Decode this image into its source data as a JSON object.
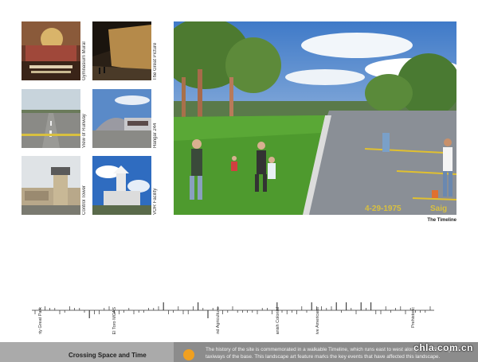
{
  "thumbnails": [
    {
      "label": "Gymnasium Mural",
      "icon": "mural-photo"
    },
    {
      "label": "The Great Picture",
      "icon": "hangar-interior-photo"
    },
    {
      "label": "View of Runway",
      "icon": "runway-photo"
    },
    {
      "label": "Hangar 244",
      "icon": "hangar-photo"
    },
    {
      "label": "Control Tower",
      "icon": "control-tower-photo"
    },
    {
      "label": "VOR Facility",
      "icon": "vor-facility-photo"
    }
  ],
  "main_image": {
    "caption": "The Timeline",
    "path_texts": [
      "4-29-1975",
      "Saig"
    ]
  },
  "timeline": {
    "labels": [
      "Orange County Great Park",
      "El Toro MCAS",
      "Statehood and Agriculture",
      "Spanish Colonial",
      "Native Americans",
      "Prehistoric"
    ]
  },
  "footer": {
    "title": "Crossing Space and Time",
    "text": "The history of the site is commemorated in a walkable Timeline, which runs east to west along one of the original taxiways of the base. This landscape art feature marks the key events that have affected this landscape.",
    "accent": "#f0a020"
  },
  "watermark": "chla.com.cn"
}
